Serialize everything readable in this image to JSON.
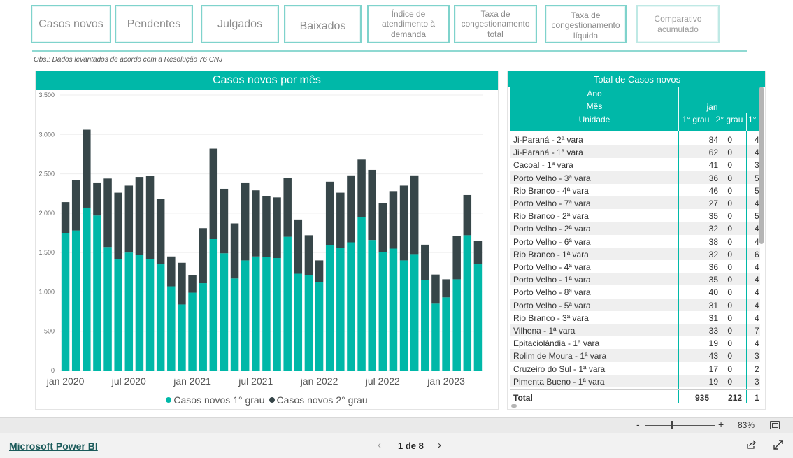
{
  "nav": {
    "casos_novos": "Casos novos",
    "pendentes": "Pendentes",
    "julgados": "Julgados",
    "baixados": "Baixados",
    "indice": "Índice de atendimento à demanda",
    "taxa_total": "Taxa de congestionamento total",
    "taxa_liquida": "Taxa de congestionamento líquida",
    "comparativo": "Comparativo acumulado"
  },
  "obs": "Obs.: Dados levantados de acordo com a Resolução 76 CNJ",
  "chart_data": {
    "type": "bar",
    "stacked": true,
    "title": "Casos novos por mês",
    "ylim": [
      0,
      3500
    ],
    "yticks": [
      "0",
      "500",
      "1.000",
      "1.500",
      "2.000",
      "2.500",
      "3.000",
      "3.500"
    ],
    "ytick_values": [
      0,
      500,
      1000,
      1500,
      2000,
      2500,
      3000,
      3500
    ],
    "xtick_labels": [
      "jan 2020",
      "jul 2020",
      "jan 2021",
      "jul 2021",
      "jan 2022",
      "jul 2022",
      "jan 2023"
    ],
    "xtick_index": [
      0,
      6,
      12,
      18,
      24,
      30,
      36
    ],
    "grid": true,
    "legend_position": "bottom",
    "series": [
      {
        "name": "Casos novos 1° grau",
        "color": "#00b8a8",
        "values": [
          1750,
          1780,
          2070,
          1970,
          1570,
          1420,
          1500,
          1470,
          1420,
          1350,
          1070,
          840,
          990,
          1110,
          1670,
          1490,
          1170,
          1400,
          1450,
          1440,
          1430,
          1700,
          1230,
          1210,
          1120,
          1590,
          1560,
          1630,
          1950,
          1660,
          1510,
          1550,
          1400,
          1480,
          1150,
          850,
          930,
          1160,
          1720,
          1350
        ]
      },
      {
        "name": "Casos novos 2° grau",
        "color": "#374649",
        "values": [
          390,
          640,
          990,
          420,
          870,
          840,
          850,
          990,
          1050,
          830,
          380,
          530,
          220,
          700,
          1150,
          820,
          700,
          990,
          840,
          780,
          770,
          750,
          690,
          510,
          280,
          810,
          700,
          850,
          730,
          890,
          620,
          730,
          950,
          1000,
          450,
          370,
          230,
          550,
          510,
          300
        ]
      }
    ]
  },
  "legend": {
    "s1": "Casos novos 1° grau",
    "s2": "Casos novos 2° grau"
  },
  "table": {
    "title": "Total de Casos novos",
    "hdr_ano": "Ano",
    "hdr_mes": "Mês",
    "hdr_unidade": "Unidade",
    "hdr_jan": "jan",
    "hdr_g1": "1° grau",
    "hdr_g2": "2° grau",
    "hdr_g1b": "1°",
    "rows": [
      {
        "u": "Ji-Paraná - 2ª vara",
        "g1": "84",
        "g2": "0",
        "n": "4"
      },
      {
        "u": "Ji-Paraná - 1ª vara",
        "g1": "62",
        "g2": "0",
        "n": "4"
      },
      {
        "u": "Cacoal - 1ª vara",
        "g1": "41",
        "g2": "0",
        "n": "3"
      },
      {
        "u": "Porto Velho - 3ª vara",
        "g1": "36",
        "g2": "0",
        "n": "5"
      },
      {
        "u": "Rio Branco - 4ª vara",
        "g1": "46",
        "g2": "0",
        "n": "5"
      },
      {
        "u": "Porto Velho - 7ª vara",
        "g1": "27",
        "g2": "0",
        "n": "4"
      },
      {
        "u": "Rio Branco - 2ª vara",
        "g1": "35",
        "g2": "0",
        "n": "5"
      },
      {
        "u": "Porto Velho - 2ª vara",
        "g1": "32",
        "g2": "0",
        "n": "4"
      },
      {
        "u": "Porto Velho - 6ª vara",
        "g1": "38",
        "g2": "0",
        "n": "4"
      },
      {
        "u": "Rio Branco - 1ª vara",
        "g1": "32",
        "g2": "0",
        "n": "6"
      },
      {
        "u": "Porto Velho - 4ª vara",
        "g1": "36",
        "g2": "0",
        "n": "4"
      },
      {
        "u": "Porto Velho - 1ª vara",
        "g1": "35",
        "g2": "0",
        "n": "4"
      },
      {
        "u": "Porto Velho - 8ª vara",
        "g1": "40",
        "g2": "0",
        "n": "4"
      },
      {
        "u": "Porto Velho - 5ª vara",
        "g1": "31",
        "g2": "0",
        "n": "4"
      },
      {
        "u": "Rio Branco - 3ª vara",
        "g1": "31",
        "g2": "0",
        "n": "4"
      },
      {
        "u": "Vilhena - 1ª vara",
        "g1": "33",
        "g2": "0",
        "n": "7"
      },
      {
        "u": "Epitaciolândia - 1ª vara",
        "g1": "19",
        "g2": "0",
        "n": "4"
      },
      {
        "u": "Rolim de Moura - 1ª vara",
        "g1": "43",
        "g2": "0",
        "n": "3"
      },
      {
        "u": "Cruzeiro do Sul - 1ª vara",
        "g1": "17",
        "g2": "0",
        "n": "2"
      },
      {
        "u": "Pimenta Bueno - 1ª vara",
        "g1": "19",
        "g2": "0",
        "n": "3"
      }
    ],
    "total_label": "Total",
    "total_g1": "935",
    "total_g2": "212",
    "total_n": "1"
  },
  "zoom": {
    "minus": "-",
    "plus": "+",
    "pct": "83%"
  },
  "footer": {
    "brand": "Microsoft Power BI",
    "pager": "1 de 8",
    "prev": "‹",
    "next": "›"
  }
}
